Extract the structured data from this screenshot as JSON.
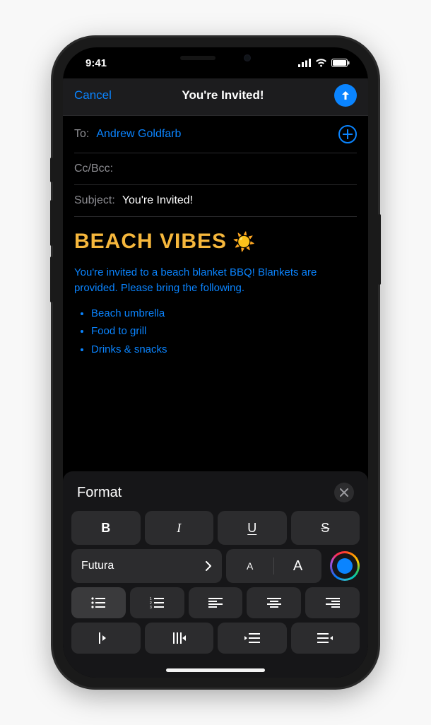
{
  "statusbar": {
    "time": "9:41"
  },
  "nav": {
    "cancel": "Cancel",
    "title": "You're Invited!"
  },
  "to": {
    "label": "To:",
    "recipient": "Andrew Goldfarb"
  },
  "ccbcc": {
    "label": "Cc/Bcc:"
  },
  "subject": {
    "label": "Subject:",
    "value": "You're Invited!"
  },
  "body": {
    "headline": "BEACH VIBES",
    "emoji": "☀️",
    "intro": "You're invited to a beach blanket BBQ! Blankets are provided. Please bring the following.",
    "items": [
      "Beach umbrella",
      "Food to grill",
      "Drinks & snacks"
    ]
  },
  "format": {
    "title": "Format",
    "bold": "B",
    "italic": "I",
    "underline": "U",
    "strike": "S",
    "font": "Futura",
    "size_small": "A",
    "size_large": "A"
  }
}
